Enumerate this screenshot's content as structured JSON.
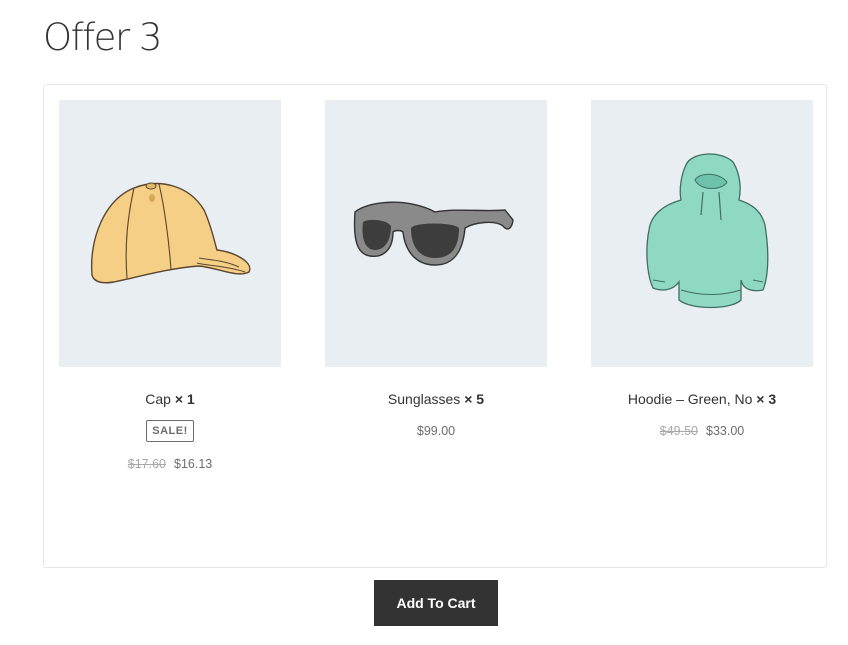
{
  "page": {
    "title": "Offer 3"
  },
  "products": [
    {
      "name": "Cap",
      "qty_label": "× 1",
      "badge": "SALE!",
      "old_price": "$17.60",
      "price": "$16.13",
      "icon": "cap-icon"
    },
    {
      "name": "Sunglasses",
      "qty_label": "× 5",
      "price": "$99.00",
      "icon": "sunglasses-icon"
    },
    {
      "name": "Hoodie – Green, No",
      "qty_label": "× 3",
      "old_price": "$49.50",
      "price": "$33.00",
      "icon": "hoodie-icon"
    }
  ],
  "actions": {
    "add_to_cart": "Add To Cart"
  },
  "colors": {
    "button_bg": "#333333",
    "thumb_bg": "#e9eef2",
    "cap": "#f5cf86",
    "hoodie": "#8fd9c4",
    "sunglasses": "#8a8a8a"
  }
}
